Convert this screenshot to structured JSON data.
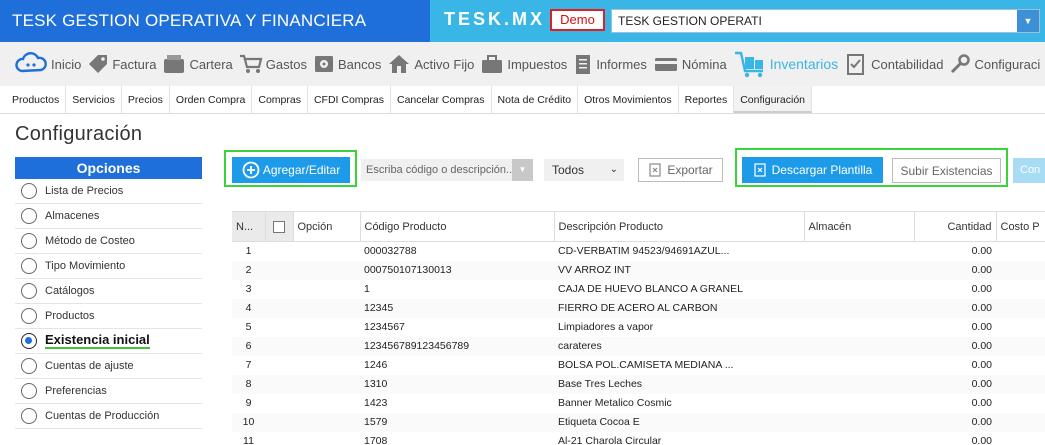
{
  "header": {
    "app_title": "TESK GESTION OPERATIVA Y FINANCIERA",
    "logo_text": "TESK.MX",
    "demo_label": "Demo",
    "company_value": "TESK GESTION OPERATI",
    "brand_color": "#1e6fd9",
    "accent_color": "#39b6e6"
  },
  "main_nav": [
    {
      "label": "Inicio",
      "icon": "cloud-icon"
    },
    {
      "label": "Factura",
      "icon": "tag-icon"
    },
    {
      "label": "Cartera",
      "icon": "wallet-icon"
    },
    {
      "label": "Gastos",
      "icon": "cart-icon"
    },
    {
      "label": "Bancos",
      "icon": "safe-icon"
    },
    {
      "label": "Activo Fijo",
      "icon": "house-icon"
    },
    {
      "label": "Impuestos",
      "icon": "briefcase-icon"
    },
    {
      "label": "Informes",
      "icon": "document-icon"
    },
    {
      "label": "Nómina",
      "icon": "card-icon"
    },
    {
      "label": "Inventarios",
      "icon": "boxes-icon",
      "active": true
    },
    {
      "label": "Contabilidad",
      "icon": "checklist-icon"
    },
    {
      "label": "Configuraci",
      "icon": "wrench-icon"
    }
  ],
  "sub_nav": [
    {
      "label": "Productos"
    },
    {
      "label": "Servicios"
    },
    {
      "label": "Precios"
    },
    {
      "label": "Orden Compra"
    },
    {
      "label": "Compras"
    },
    {
      "label": "CFDI Compras"
    },
    {
      "label": "Cancelar Compras"
    },
    {
      "label": "Nota de Crédito"
    },
    {
      "label": "Otros Movimientos"
    },
    {
      "label": "Reportes"
    },
    {
      "label": "Configuración",
      "active": true
    }
  ],
  "page_title": "Configuración",
  "sidebar": {
    "header": "Opciones",
    "items": [
      {
        "label": "Lista de Precios"
      },
      {
        "label": "Almacenes"
      },
      {
        "label": "Método de Costeo"
      },
      {
        "label": "Tipo Movimiento"
      },
      {
        "label": "Catálogos"
      },
      {
        "label": "Productos"
      },
      {
        "label": "Existencia inicial",
        "selected": true
      },
      {
        "label": "Cuentas de ajuste"
      },
      {
        "label": "Preferencias"
      },
      {
        "label": "Cuentas de Producción"
      }
    ]
  },
  "toolbar": {
    "add_edit_label": "Agregar/Editar",
    "search_placeholder": "Escriba código o descripción...",
    "filter_value": "Todos",
    "export_label": "Exportar",
    "download_template_label": "Descargar Plantilla",
    "upload_stock_label": "Subir Existencias",
    "cut_button_label": "Con"
  },
  "table": {
    "columns": [
      "N...",
      "",
      "Opción",
      "Código Producto",
      "Descripción Producto",
      "Almacén",
      "Cantidad",
      "Costo P"
    ],
    "rows": [
      {
        "n": "1",
        "codigo": "000032788",
        "descripcion": "CD-VERBATIM 94523/94691AZUL...",
        "almacen": "",
        "cantidad": "0.00"
      },
      {
        "n": "2",
        "codigo": "000750107130013",
        "descripcion": "VV ARROZ INT",
        "almacen": "",
        "cantidad": "0.00"
      },
      {
        "n": "3",
        "codigo": "1",
        "descripcion": "CAJA DE HUEVO BLANCO A GRANEL",
        "almacen": "",
        "cantidad": "0.00"
      },
      {
        "n": "4",
        "codigo": "12345",
        "descripcion": "FIERRO DE ACERO AL CARBON",
        "almacen": "",
        "cantidad": "0.00"
      },
      {
        "n": "5",
        "codigo": "1234567",
        "descripcion": "Limpiadores a vapor",
        "almacen": "",
        "cantidad": "0.00"
      },
      {
        "n": "6",
        "codigo": "123456789123456789",
        "descripcion": "carateres",
        "almacen": "",
        "cantidad": "0.00"
      },
      {
        "n": "7",
        "codigo": "1246",
        "descripcion": "BOLSA POL.CAMISETA MEDIANA ...",
        "almacen": "",
        "cantidad": "0.00"
      },
      {
        "n": "8",
        "codigo": "1310",
        "descripcion": "Base Tres Leches",
        "almacen": "",
        "cantidad": "0.00"
      },
      {
        "n": "9",
        "codigo": "1423",
        "descripcion": "Banner Metalico Cosmic",
        "almacen": "",
        "cantidad": "0.00"
      },
      {
        "n": "10",
        "codigo": "1579",
        "descripcion": "Etiqueta Cocoa E",
        "almacen": "",
        "cantidad": "0.00"
      },
      {
        "n": "11",
        "codigo": "1708",
        "descripcion": "Al-21 Charola Circular",
        "almacen": "",
        "cantidad": "0.00"
      }
    ]
  }
}
